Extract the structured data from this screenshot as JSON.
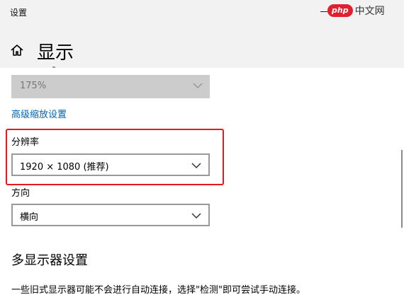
{
  "window": {
    "title": "设置",
    "watermark_logo": "php",
    "watermark_text": "中文网"
  },
  "header": {
    "title": "显示"
  },
  "scale": {
    "value": "175%"
  },
  "advanced_scaling_link": "高级缩放设置",
  "resolution": {
    "label": "分辨率",
    "value": "1920 × 1080 (推荐)"
  },
  "orientation": {
    "label": "方向",
    "value": "横向"
  },
  "multi_display": {
    "heading": "多显示器设置",
    "description": "一些旧式显示器可能不会进行自动连接，选择\"检测\"即可尝试手动连接。"
  },
  "colors": {
    "highlight": "#e8191c",
    "link": "#0063b1",
    "header_bg": "#f2f2f2"
  }
}
